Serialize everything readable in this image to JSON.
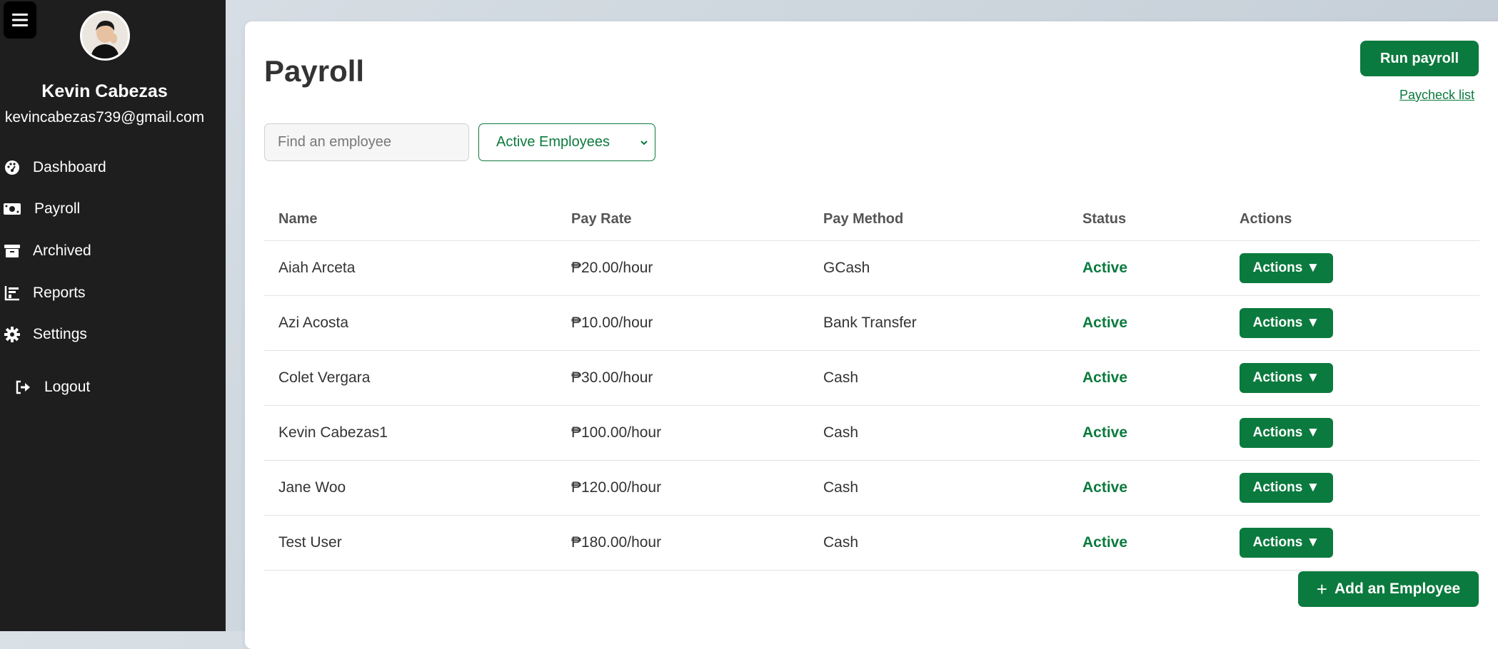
{
  "sidebar": {
    "menu_icon": "hamburger-icon",
    "user": {
      "name": "Kevin Cabezas",
      "email": "kevincabezas739@gmail.com"
    },
    "items": [
      {
        "label": "Dashboard",
        "icon": "dashboard-icon"
      },
      {
        "label": "Payroll",
        "icon": "money-icon"
      },
      {
        "label": "Archived",
        "icon": "archive-icon"
      },
      {
        "label": "Reports",
        "icon": "chart-icon"
      },
      {
        "label": "Settings",
        "icon": "gear-icon"
      },
      {
        "label": "Logout",
        "icon": "logout-icon"
      }
    ]
  },
  "main": {
    "title": "Payroll",
    "run_payroll_label": "Run payroll",
    "paycheck_list_label": "Paycheck list",
    "search": {
      "placeholder": "Find an employee",
      "value": ""
    },
    "filter": {
      "selected": "Active Employees"
    },
    "table": {
      "headers": [
        "Name",
        "Pay Rate",
        "Pay Method",
        "Status",
        "Actions"
      ],
      "rows": [
        {
          "name": "Aiah Arceta",
          "rate": "₱20.00/hour",
          "method": "GCash",
          "status": "Active",
          "action": "Actions ▼"
        },
        {
          "name": "Azi Acosta",
          "rate": "₱10.00/hour",
          "method": "Bank Transfer",
          "status": "Active",
          "action": "Actions ▼"
        },
        {
          "name": "Colet Vergara",
          "rate": "₱30.00/hour",
          "method": "Cash",
          "status": "Active",
          "action": "Actions ▼"
        },
        {
          "name": "Kevin Cabezas1",
          "rate": "₱100.00/hour",
          "method": "Cash",
          "status": "Active",
          "action": "Actions ▼"
        },
        {
          "name": "Jane Woo",
          "rate": "₱120.00/hour",
          "method": "Cash",
          "status": "Active",
          "action": "Actions ▼"
        },
        {
          "name": "Test User",
          "rate": "₱180.00/hour",
          "method": "Cash",
          "status": "Active",
          "action": "Actions ▼"
        }
      ]
    },
    "add_employee_label": "Add an Employee"
  },
  "colors": {
    "sidebar_bg": "#1e1e1e",
    "accent": "#0b7a3e",
    "text": "#333333"
  }
}
